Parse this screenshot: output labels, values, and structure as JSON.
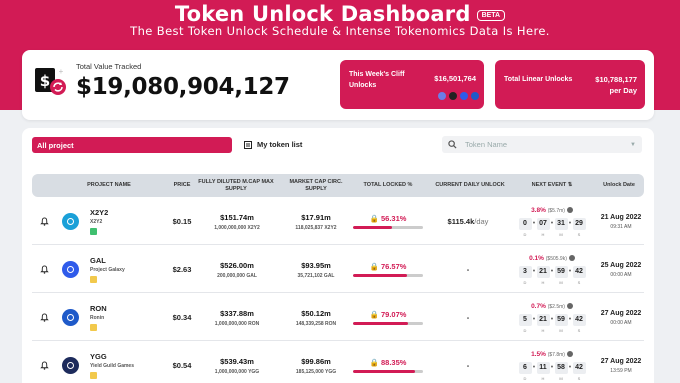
{
  "header": {
    "title": "Token Unlock Dashboard",
    "badge": "BETA",
    "subtitle": "The Best Token Unlock Schedule & Intense Tokenomics Data Is Here."
  },
  "summary": {
    "total_label": "Total Value Tracked",
    "total_value": "$19,080,904,127",
    "cliff_label": "This Week's Cliff Unlocks",
    "cliff_value": "$16,501,764",
    "linear_label": "Total Linear Unlocks",
    "linear_value": "$10,788,177",
    "linear_unit": "per Day"
  },
  "filters": {
    "all_label": "All project",
    "mine_label": "My token list",
    "search_placeholder": "Token Name"
  },
  "table": {
    "headers": {
      "project": "PROJECT NAME",
      "price": "PRICE",
      "fdmc": "FULLY DILUTED M.CAP MAX SUPPLY",
      "mcap": "MARKET CAP CIRC. SUPPLY",
      "locked": "TOTAL LOCKED %",
      "daily": "CURRENT DAILY UNLOCK",
      "next": "NEXT EVENT",
      "date": "Unlock Date"
    },
    "countdown_units": [
      "D",
      "H",
      "M",
      "S"
    ],
    "rows": [
      {
        "symbol": "X2Y2",
        "name": "X2Y2",
        "price": "$0.15",
        "fdmc": "$151.74m",
        "max_supply": "1,000,000,000 X2Y2",
        "mcap": "$17.91m",
        "circ_supply": "118,025,837 X2Y2",
        "locked": "56.31%",
        "locked_frac": 0.5631,
        "daily": "$115.4k",
        "daily_unit": "/day",
        "event_pct": "3.8%",
        "event_amt": "($5.7m)",
        "cd": [
          "0",
          "07",
          "31",
          "29"
        ],
        "date": "21 Aug 2022",
        "time": "09:31 AM",
        "logo_color": "#1aa0d8",
        "tag_color": "#3fbf6f"
      },
      {
        "symbol": "GAL",
        "name": "Project Galaxy",
        "price": "$2.63",
        "fdmc": "$526.00m",
        "max_supply": "200,000,000 GAL",
        "mcap": "$93.95m",
        "circ_supply": "35,721,102 GAL",
        "locked": "76.57%",
        "locked_frac": 0.7657,
        "daily": "-",
        "daily_unit": "",
        "event_pct": "0.1%",
        "event_amt": "($505.9k)",
        "cd": [
          "3",
          "21",
          "59",
          "42"
        ],
        "date": "25 Aug 2022",
        "time": "00:00 AM",
        "logo_color": "#2f5bea",
        "tag_color": "#f2c94c"
      },
      {
        "symbol": "RON",
        "name": "Ronin",
        "price": "$0.34",
        "fdmc": "$337.88m",
        "max_supply": "1,000,000,000 RON",
        "mcap": "$50.12m",
        "circ_supply": "148,339,258 RON",
        "locked": "79.07%",
        "locked_frac": 0.7907,
        "daily": "-",
        "daily_unit": "",
        "event_pct": "0.7%",
        "event_amt": "($2.5m)",
        "cd": [
          "5",
          "21",
          "59",
          "42"
        ],
        "date": "27 Aug 2022",
        "time": "00:00 AM",
        "logo_color": "#1f5ac9",
        "tag_color": "#f2c94c"
      },
      {
        "symbol": "YGG",
        "name": "Yield Guild Games",
        "price": "$0.54",
        "fdmc": "$539.43m",
        "max_supply": "1,000,000,000 YGG",
        "mcap": "$99.86m",
        "circ_supply": "185,125,000 YGG",
        "locked": "88.35%",
        "locked_frac": 0.8835,
        "daily": "-",
        "daily_unit": "",
        "event_pct": "1.5%",
        "event_amt": "($7.8m)",
        "cd": [
          "6",
          "11",
          "58",
          "42"
        ],
        "date": "27 Aug 2022",
        "time": "13:59 PM",
        "logo_color": "#1d2b5c",
        "tag_color": "#f2c94c"
      }
    ]
  },
  "colors": {
    "accent": "#d21b55",
    "background": "#eef0f3",
    "table_header": "#d8dde3"
  }
}
